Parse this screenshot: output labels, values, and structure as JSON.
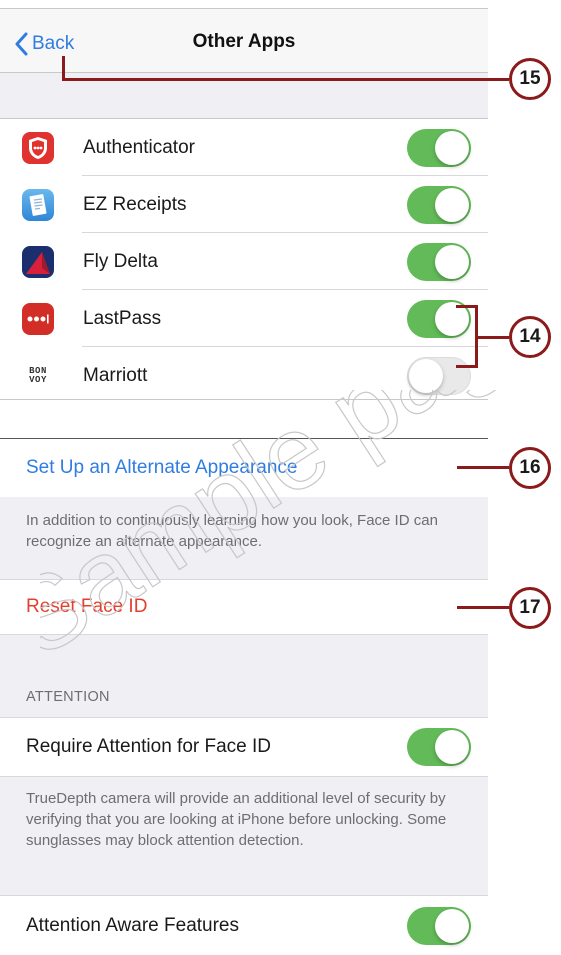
{
  "panel1": {
    "back_label": "Back",
    "title": "Other Apps",
    "apps": [
      {
        "label": "Authenticator",
        "icon": "authenticator-icon",
        "enabled": true
      },
      {
        "label": "EZ Receipts",
        "icon": "ez-receipts-icon",
        "enabled": true
      },
      {
        "label": "Fly Delta",
        "icon": "fly-delta-icon",
        "enabled": true
      },
      {
        "label": "LastPass",
        "icon": "lastpass-icon",
        "enabled": true
      },
      {
        "label": "Marriott",
        "icon": "marriott-bonvoy-icon",
        "enabled": false
      }
    ],
    "marriott_icon_text_top": "BON",
    "marriott_icon_text_bottom": "VOY"
  },
  "panel2": {
    "alternate_appearance_label": "Set Up an Alternate Appearance",
    "alternate_appearance_footer": "In addition to continuously learning how you look, Face ID can recognize an alternate appearance.",
    "reset_label": "Reset Face ID",
    "attention_header": "ATTENTION",
    "require_attention_label": "Require Attention for Face ID",
    "require_attention_enabled": true,
    "require_attention_footer": "TrueDepth camera will provide an additional level of security by verifying that you are looking at iPhone before unlocking. Some sunglasses may block attention detection.",
    "attention_aware_label": "Attention Aware Features",
    "attention_aware_enabled": true
  },
  "callouts": {
    "c15": "15",
    "c14": "14",
    "c16": "16",
    "c17": "17"
  },
  "watermark_text": "Sample pages",
  "colors": {
    "toggle_on": "#62bb58",
    "link_blue": "#2f7de1",
    "destructive_red": "#e5402f",
    "callout": "#8b1a1a",
    "grouped_background": "#efeff4"
  }
}
